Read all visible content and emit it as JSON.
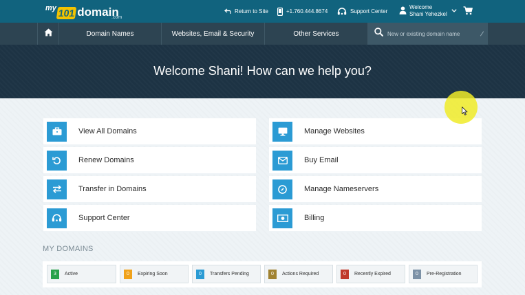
{
  "header": {
    "logo": {
      "my": "my",
      "number": "101",
      "word": "domain",
      "suffix": ".com"
    },
    "return_label": "Return to Site",
    "phone": "+1.760.444.8674",
    "support_label": "Support Center",
    "welcome_line1": "Welcome",
    "welcome_line2": "Shani Yehezkel"
  },
  "nav": {
    "items": [
      {
        "label": "Domain Names"
      },
      {
        "label": "Websites, Email & Security"
      },
      {
        "label": "Other Services"
      }
    ],
    "search_placeholder": "New or existing domain name"
  },
  "hero": {
    "title": "Welcome Shani! How can we help you?"
  },
  "actions": {
    "left": [
      {
        "label": "View All Domains",
        "icon": "briefcase-icon"
      },
      {
        "label": "Renew Domains",
        "icon": "renew-icon"
      },
      {
        "label": "Transfer in Domains",
        "icon": "transfer-icon"
      },
      {
        "label": "Support Center",
        "icon": "support-icon"
      }
    ],
    "right": [
      {
        "label": "Manage Websites",
        "icon": "monitor-icon"
      },
      {
        "label": "Buy Email",
        "icon": "envelope-icon"
      },
      {
        "label": "Manage Nameservers",
        "icon": "compass-icon"
      },
      {
        "label": "Billing",
        "icon": "money-icon"
      }
    ]
  },
  "my_domains": {
    "title": "MY DOMAINS",
    "stats": [
      {
        "count": "3",
        "label": "Active",
        "color": "#2aa24c"
      },
      {
        "count": "0",
        "label": "Expiring Soon",
        "color": "#f0a21b"
      },
      {
        "count": "0",
        "label": "Transfers Pending",
        "color": "#2b9bd4"
      },
      {
        "count": "0",
        "label": "Actions Required",
        "color": "#a08231"
      },
      {
        "count": "0",
        "label": "Recently Expired",
        "color": "#c0392b"
      },
      {
        "count": "0",
        "label": "Pre-Registration",
        "color": "#7c91a6"
      }
    ]
  },
  "colors": {
    "topbar": "#11637e",
    "nav": "#2d4452",
    "hero": "#1d3344",
    "accent": "#2b9bd4"
  }
}
